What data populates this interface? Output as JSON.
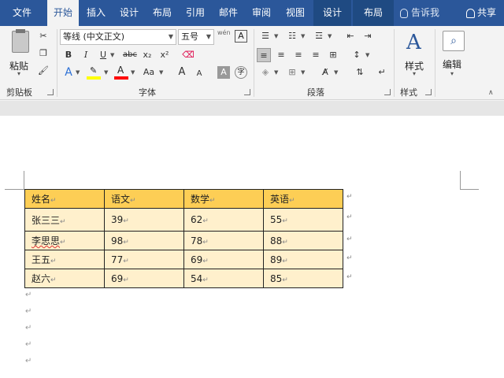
{
  "tabs": [
    "文件",
    "开始",
    "插入",
    "设计",
    "布局",
    "引用",
    "邮件",
    "审阅",
    "视图",
    "设计",
    "布局"
  ],
  "tell_me": "告诉我",
  "share": "共享",
  "clipboard": {
    "paste": "粘贴",
    "group": "剪贴板"
  },
  "font": {
    "name": "等线 (中文正文)",
    "size": "五号",
    "wen": "wén",
    "bold": "B",
    "italic": "I",
    "underline": "U",
    "strike": "abc",
    "sub": "x₂",
    "sup": "x²",
    "change_case": "Aa",
    "grow": "A",
    "shrink": "A",
    "char_border": "A",
    "phonetic": "A",
    "enclose": "字",
    "group": "字体"
  },
  "paragraph": {
    "group": "段落"
  },
  "styles": {
    "label": "样式",
    "group": "样式"
  },
  "editing": {
    "label": "编辑"
  },
  "table": {
    "headers": [
      "姓名",
      "语文",
      "数学",
      "英语"
    ],
    "rows": [
      [
        "张三三",
        "39",
        "62",
        "55"
      ],
      [
        "李思思",
        "98",
        "78",
        "88"
      ],
      [
        "王五",
        "77",
        "69",
        "89"
      ],
      [
        "赵六",
        "69",
        "54",
        "85"
      ]
    ]
  },
  "colors": {
    "accent": "#2b579a",
    "header_fill": "#fdce55",
    "row_fill": "#fff0cc",
    "highlight": "#ffff00",
    "font_color": "#ff0000"
  }
}
